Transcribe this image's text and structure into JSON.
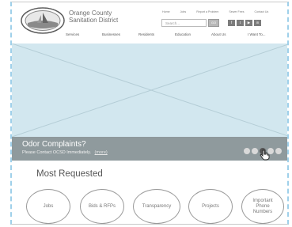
{
  "org": {
    "line1": "Orange County",
    "line2": "Sanitation District"
  },
  "topnav": [
    "Home",
    "Jobs",
    "Report a Problem",
    "Sewer Fees",
    "Contact Us"
  ],
  "search": {
    "placeholder": "Search...",
    "button": "GO"
  },
  "social": [
    "f",
    "t",
    "▶",
    "in"
  ],
  "mainnav": [
    "Services",
    "Businesses",
    "Residents",
    "Education",
    "About Us",
    "I Want To..."
  ],
  "banner": {
    "title": "Odor Complaints?",
    "subtitle": "Please Contact OCSD Immediately.",
    "link": "(more)"
  },
  "most_requested": {
    "title": "Most Requested",
    "items": [
      "Jobs",
      "Bids & RFPs",
      "Transparency",
      "Projects",
      "Important Phone Numbers"
    ]
  },
  "colors": {
    "hero": "#d2e7ef",
    "banner": "#8f9a9d",
    "frame_dash": "#9fd0ea"
  }
}
